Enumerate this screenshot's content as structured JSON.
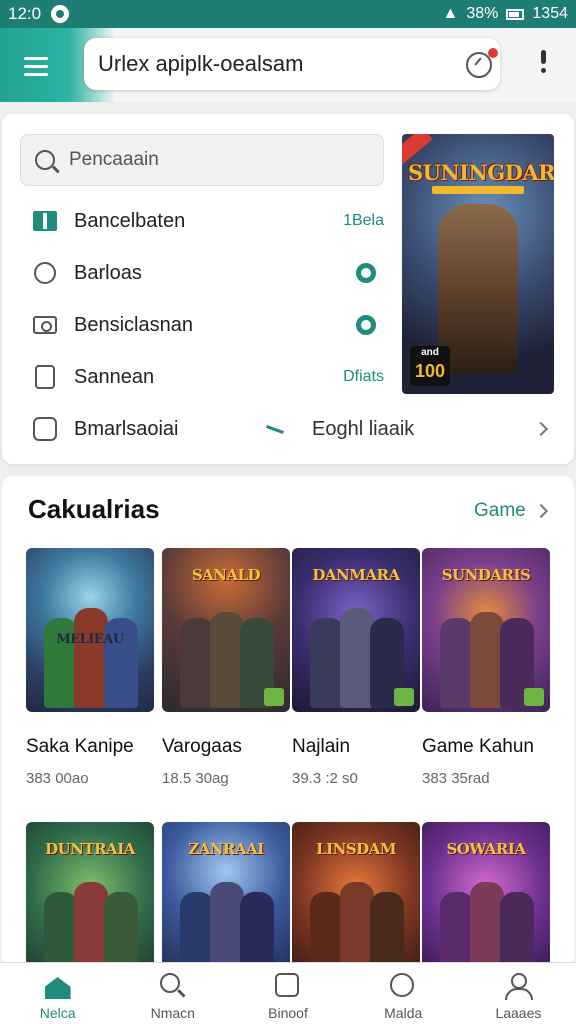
{
  "status_bar": {
    "time": "12:0",
    "right_text": "38%",
    "right_text2": "1354"
  },
  "app_bar": {
    "url_text": "Urlex apiplk-oealsam"
  },
  "search": {
    "placeholder": "Pencaaain"
  },
  "menu_rows": [
    {
      "label": "Bancelbaten",
      "value": "1Bela",
      "icon": "book-icon"
    },
    {
      "label": "Barloas",
      "value": "",
      "icon": "chat-icon"
    },
    {
      "label": "Bensiclasnan",
      "value": "",
      "icon": "camera-icon"
    },
    {
      "label": "Sannean",
      "value": "Dfiats",
      "icon": "door-icon"
    },
    {
      "label": "Bmarlsaoiai",
      "value": "Eoghl liaaik",
      "icon": "gamepad-icon"
    }
  ],
  "poster": {
    "title": "SUNINGDAR",
    "badge_top": "and",
    "badge_num": "100"
  },
  "section": {
    "title": "Cakualrias",
    "link": "Game"
  },
  "games": [
    {
      "name": "Saka Kanipe",
      "meta": "383 00ao",
      "thumb_title": "MELIEAU"
    },
    {
      "name": "Varogaas",
      "meta": "18.5 30ag",
      "thumb_title": "SANALD"
    },
    {
      "name": "Najlain",
      "meta": "39.3 :2 s0",
      "thumb_title": "DANMARA"
    },
    {
      "name": "Game Kahun",
      "meta": "383 35rad",
      "thumb_title": "SUNDARIS"
    }
  ],
  "games_row2": [
    {
      "thumb_title": "DUNTRAIA"
    },
    {
      "thumb_title": "ZANRAAI"
    },
    {
      "thumb_title": "LINSDAM"
    },
    {
      "thumb_title": "SOWARIA"
    }
  ],
  "bottom_nav": [
    {
      "label": "Nelca",
      "icon": "home-icon",
      "active": true
    },
    {
      "label": "Nmacn",
      "icon": "search-icon"
    },
    {
      "label": "Binoof",
      "icon": "square-icon"
    },
    {
      "label": "Malda",
      "icon": "clock-icon"
    },
    {
      "label": "Laaaes",
      "icon": "user-icon"
    }
  ],
  "colors": {
    "accent": "#1f8c7e",
    "status_bar": "#1f7e74",
    "badge_red": "#e23b2f"
  }
}
